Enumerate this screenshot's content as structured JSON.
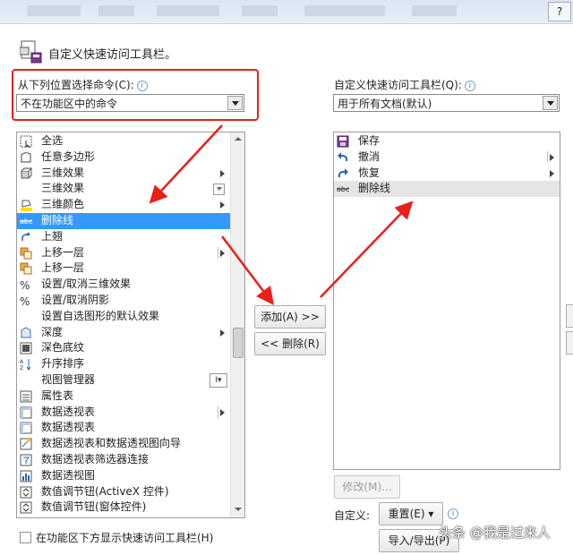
{
  "window": {
    "help_glyph": "?"
  },
  "dialog": {
    "title": "自定义快速访问工具栏。"
  },
  "left": {
    "label": "从下列位置选择命令(C):",
    "combo_value": "不在功能区中的命令",
    "items": [
      {
        "label": "全选",
        "icon": "select-all-icon",
        "submenu": ""
      },
      {
        "label": "任意多边形",
        "icon": "freeform-icon",
        "submenu": ""
      },
      {
        "label": "三维效果",
        "icon": "3d-effect-icon",
        "submenu": "arrow"
      },
      {
        "label": "三维效果",
        "icon": "",
        "submenu": "dropdown"
      },
      {
        "label": "三维颜色",
        "icon": "3d-color-icon",
        "submenu": "arrow"
      },
      {
        "label": "删除线",
        "icon": "strikethrough-icon",
        "submenu": "",
        "selected": true
      },
      {
        "label": "上翘",
        "icon": "tilt-up-icon",
        "submenu": ""
      },
      {
        "label": "上移一层",
        "icon": "bring-forward-icon",
        "submenu": "arrow-box"
      },
      {
        "label": "上移一层",
        "icon": "bring-forward-icon",
        "submenu": ""
      },
      {
        "label": "设置/取消三维效果",
        "icon": "toggle-3d-icon",
        "submenu": ""
      },
      {
        "label": "设置/取消阴影",
        "icon": "toggle-shadow-icon",
        "submenu": ""
      },
      {
        "label": "设置自选图形的默认效果",
        "icon": "",
        "submenu": ""
      },
      {
        "label": "深度",
        "icon": "depth-icon",
        "submenu": "arrow"
      },
      {
        "label": "深色底纹",
        "icon": "dark-shading-icon",
        "submenu": ""
      },
      {
        "label": "升序排序",
        "icon": "sort-ascending-icon",
        "submenu": ""
      },
      {
        "label": "视图管理器",
        "icon": "",
        "submenu": "text-box"
      },
      {
        "label": "属性表",
        "icon": "property-sheet-icon",
        "submenu": ""
      },
      {
        "label": "数据透视表",
        "icon": "pivot-table-icon",
        "submenu": "arrow-box"
      },
      {
        "label": "数据透视表",
        "icon": "pivot-table-icon",
        "submenu": ""
      },
      {
        "label": "数据透视表和数据透视图向导",
        "icon": "pivot-wizard-icon",
        "submenu": ""
      },
      {
        "label": "数据透视表筛选器连接",
        "icon": "pivot-filter-icon",
        "submenu": ""
      },
      {
        "label": "数据透视图",
        "icon": "pivot-chart-icon",
        "submenu": ""
      },
      {
        "label": "数值调节钮(ActiveX 控件)",
        "icon": "spinner-icon",
        "submenu": ""
      },
      {
        "label": "数值调节钮(窗体控件)",
        "icon": "spinner-icon",
        "submenu": ""
      }
    ],
    "view_manager_badge": "I▾",
    "checkbox_label": "在功能区下方显示快速访问工具栏(H)"
  },
  "right": {
    "label": "自定义快速访问工具栏(Q):",
    "combo_value": "用于所有文档(默认)",
    "items": [
      {
        "label": "保存",
        "icon": "save-icon",
        "submenu": ""
      },
      {
        "label": "撤消",
        "icon": "undo-icon",
        "submenu": "arrow-box"
      },
      {
        "label": "恢复",
        "icon": "redo-icon",
        "submenu": "arrow"
      },
      {
        "label": "删除线",
        "icon": "strikethrough-icon",
        "submenu": "",
        "highlighted": true
      }
    ],
    "modify_button": "修改(M)...",
    "customize_label": "自定义:",
    "reset_button": "重置(E) ▾",
    "import_export_button": "导入/导出(P)"
  },
  "middle": {
    "add_button": "添加(A) >>",
    "remove_button": "<< 删除(R)"
  },
  "watermark": "头条 @我是过来人",
  "colors": {
    "selection": "#3399ff",
    "annotation_red": "#e8201a"
  }
}
